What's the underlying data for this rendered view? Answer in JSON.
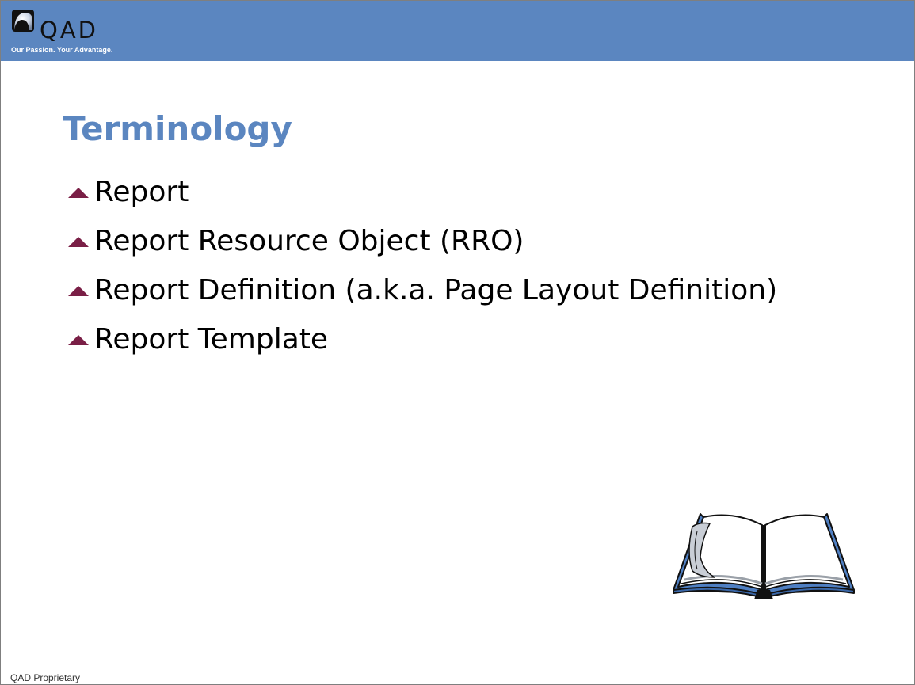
{
  "header": {
    "logo_text": "QAD",
    "tagline": "Our Passion. Your Advantage.",
    "band_color": "#5b86c0"
  },
  "slide": {
    "title": "Terminology",
    "bullets": [
      "Report",
      "Report Resource Object (RRO)",
      "Report Definition (a.k.a. Page Layout Definition)",
      "Report Template"
    ],
    "bullet_icon": "triangle-bullet-icon",
    "bullet_color": "#7a1f46",
    "title_color": "#5b86c0",
    "illustration": "open-book-icon"
  },
  "footer": {
    "text": "QAD Proprietary"
  }
}
